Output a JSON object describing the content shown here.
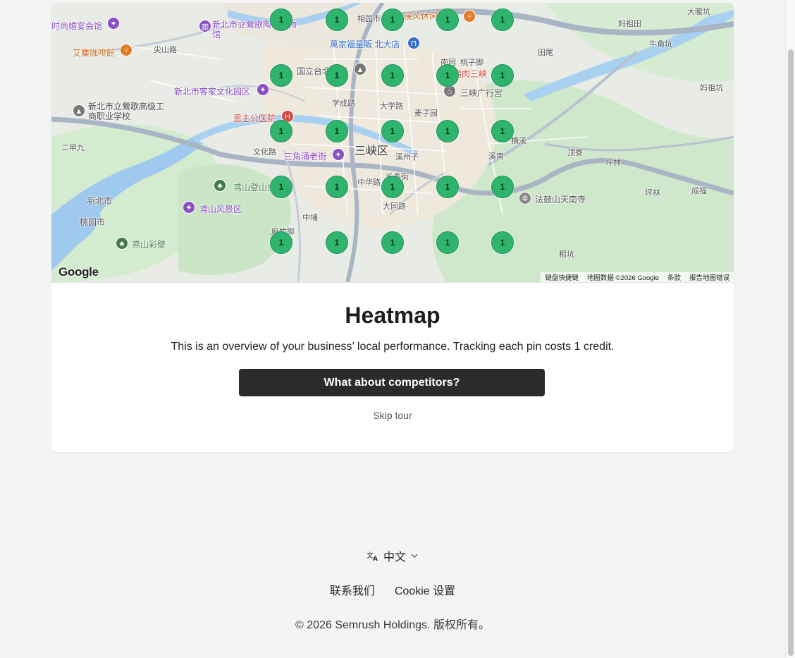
{
  "map": {
    "logo": "Google",
    "attribution": [
      "键盘快捷键",
      "地图数据 ©2026 Google",
      "条款",
      "报告地图错误"
    ],
    "labels": {
      "l1": "时尚婚宴会馆",
      "l2": "艾麋咖啡館",
      "l3": "尖山路",
      "l4": "新北市立鶯歌陶瓷博物馆",
      "l5": "新北市客家文化园区",
      "l6": "新北市立鶯歌高级工商职业学校",
      "l7": "二甲九",
      "l8": "恩主公医院",
      "l9": "三角涌老街",
      "l10": "三峡区",
      "l11": "溪州子",
      "l12": "新北市",
      "l13": "桃园市",
      "l14": "鸢山登山步道",
      "l15": "鸢山风景区",
      "l16": "鸢山彩壁",
      "l17": "中埔",
      "l18": "麻竹脚",
      "l19": "萬家福量販 北大店",
      "l20": "国立台北大学",
      "l21": "南园",
      "l22": "桃子脚",
      "l23": "三峡广行宫",
      "l24": "学成路",
      "l25": "麦子园",
      "l26": "大学路",
      "l27": "横溪",
      "l28": "溪南",
      "l29": "顶寮",
      "l30": "坪林",
      "l31": "法鼓山天南寺",
      "l32": "坪林",
      "l33": "成福",
      "l34": "粗坑",
      "l35": "大暖坑",
      "l36": "妈祖田",
      "l37": "牛角坑",
      "l38": "田尾",
      "l39": "妈祖坑",
      "l40": "相园市",
      "l41": "文化路",
      "l42": "中华路",
      "l43": "长泰街",
      "l44": "大同路",
      "l45": "溪风休闲",
      "l46": "鹅肉三峡"
    },
    "pins": [
      {
        "label": "1"
      },
      {
        "label": "1"
      },
      {
        "label": "1"
      },
      {
        "label": "1"
      },
      {
        "label": "1"
      },
      {
        "label": "1"
      },
      {
        "label": "1"
      },
      {
        "label": "1"
      },
      {
        "label": "1"
      },
      {
        "label": "1"
      },
      {
        "label": "1"
      },
      {
        "label": "1"
      },
      {
        "label": "1"
      },
      {
        "label": "1"
      },
      {
        "label": "1"
      },
      {
        "label": "1"
      },
      {
        "label": "1"
      },
      {
        "label": "1"
      },
      {
        "label": "1"
      },
      {
        "label": "1"
      },
      {
        "label": "1"
      },
      {
        "label": "1"
      },
      {
        "label": "1"
      },
      {
        "label": "1"
      },
      {
        "label": "1"
      }
    ],
    "pin_color": "#2fb46e"
  },
  "tour": {
    "title": "Heatmap",
    "description": "This is an overview of your business’ local performance. Tracking each pin costs 1 credit.",
    "cta_label": "What about competitors?",
    "skip_label": "Skip tour"
  },
  "footer": {
    "language": "中文",
    "links": [
      "联系我们",
      "Cookie 设置"
    ],
    "copyright": "© 2026 Semrush Holdings. 版权所有。"
  },
  "icons": {
    "language": "translate-icon",
    "chevron": "chevron-down-icon"
  }
}
